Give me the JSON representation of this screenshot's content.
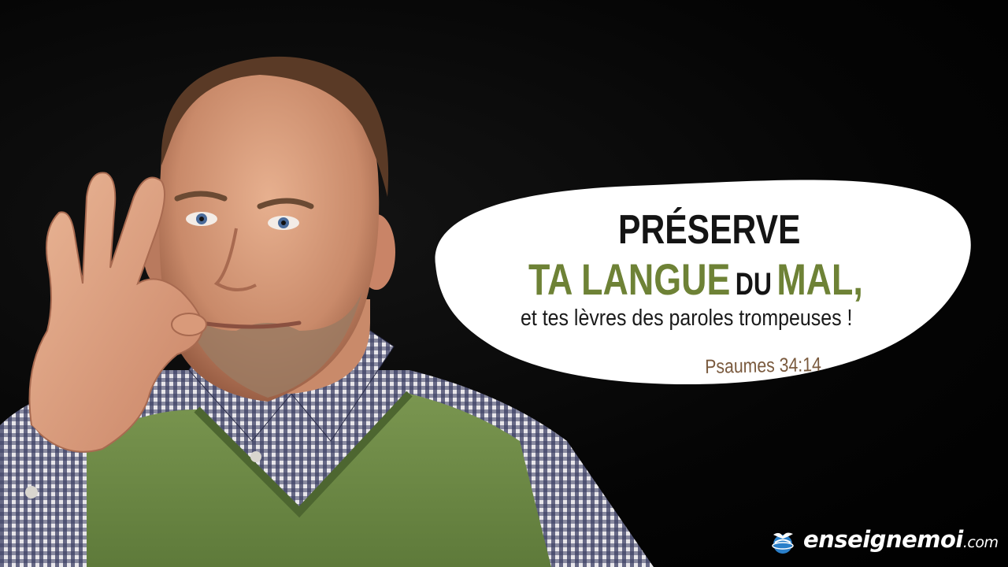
{
  "quote": {
    "line1": "PRÉSERVE",
    "line2_a": "TA LANGUE",
    "line2_b": "DU",
    "line2_c": "MAL,",
    "line3": "et tes lèvres des paroles trompeuses !",
    "reference": "Psaumes 34:14"
  },
  "brand": {
    "name": "enseignemoi",
    "domain": ".com",
    "icon": "globe-bird-icon"
  },
  "photo": {
    "subject": "man-zipping-lips",
    "icon": "silence-gesture"
  },
  "colors": {
    "background": "#000000",
    "bubble": "#ffffff",
    "accent_green": "#6e8236",
    "reference_brown": "#7a5a3e",
    "vest_green": "#6f8a45",
    "logo_blue": "#2a7fc9"
  }
}
